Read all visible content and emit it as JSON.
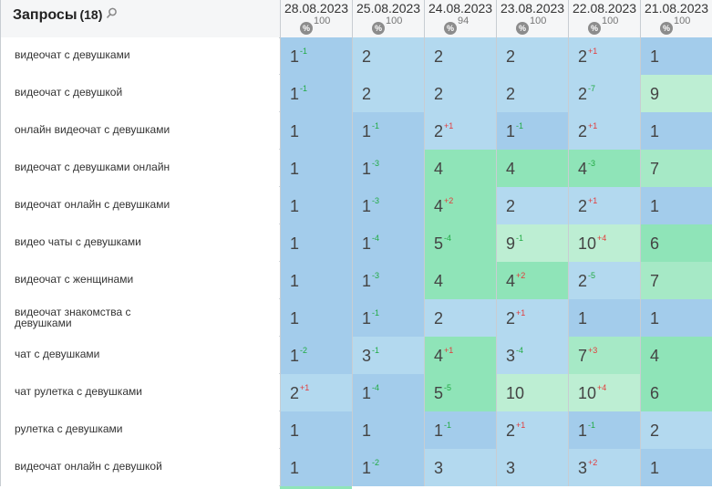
{
  "header": {
    "title": "Запросы",
    "count": "(18)",
    "dates": [
      {
        "date": "28.08.2023",
        "pct_icon": "%",
        "pct": "100"
      },
      {
        "date": "25.08.2023",
        "pct_icon": "%",
        "pct": "100"
      },
      {
        "date": "24.08.2023",
        "pct_icon": "%",
        "pct": "94"
      },
      {
        "date": "23.08.2023",
        "pct_icon": "%",
        "pct": "100"
      },
      {
        "date": "22.08.2023",
        "pct_icon": "%",
        "pct": "100"
      },
      {
        "date": "21.08.2023",
        "pct_icon": "%",
        "pct": "100"
      }
    ]
  },
  "rows": [
    {
      "query": "видеочат с девушками",
      "cells": [
        {
          "v": "1",
          "d": "-1",
          "dir": "up",
          "c": "blue1"
        },
        {
          "v": "2",
          "d": "",
          "dir": "",
          "c": "blue2"
        },
        {
          "v": "2",
          "d": "",
          "dir": "",
          "c": "blue2"
        },
        {
          "v": "2",
          "d": "",
          "dir": "",
          "c": "blue2"
        },
        {
          "v": "2",
          "d": "+1",
          "dir": "down",
          "c": "blue2"
        },
        {
          "v": "1",
          "d": "",
          "dir": "",
          "c": "blue1"
        }
      ]
    },
    {
      "query": "видеочат с девушкой",
      "cells": [
        {
          "v": "1",
          "d": "-1",
          "dir": "up",
          "c": "blue1"
        },
        {
          "v": "2",
          "d": "",
          "dir": "",
          "c": "blue2"
        },
        {
          "v": "2",
          "d": "",
          "dir": "",
          "c": "blue2"
        },
        {
          "v": "2",
          "d": "",
          "dir": "",
          "c": "blue2"
        },
        {
          "v": "2",
          "d": "-7",
          "dir": "up",
          "c": "blue2"
        },
        {
          "v": "9",
          "d": "",
          "dir": "",
          "c": "green2"
        }
      ]
    },
    {
      "query": "онлайн видеочат с девушками",
      "cells": [
        {
          "v": "1",
          "d": "",
          "dir": "",
          "c": "blue1"
        },
        {
          "v": "1",
          "d": "-1",
          "dir": "up",
          "c": "blue1"
        },
        {
          "v": "2",
          "d": "+1",
          "dir": "down",
          "c": "blue2"
        },
        {
          "v": "1",
          "d": "-1",
          "dir": "up",
          "c": "blue1"
        },
        {
          "v": "2",
          "d": "+1",
          "dir": "down",
          "c": "blue2"
        },
        {
          "v": "1",
          "d": "",
          "dir": "",
          "c": "blue1"
        }
      ]
    },
    {
      "query": "видеочат с девушками онлайн",
      "cells": [
        {
          "v": "1",
          "d": "",
          "dir": "",
          "c": "blue1"
        },
        {
          "v": "1",
          "d": "-3",
          "dir": "up",
          "c": "blue1"
        },
        {
          "v": "4",
          "d": "",
          "dir": "",
          "c": "green1"
        },
        {
          "v": "4",
          "d": "",
          "dir": "",
          "c": "green1"
        },
        {
          "v": "4",
          "d": "-3",
          "dir": "up",
          "c": "green1"
        },
        {
          "v": "7",
          "d": "",
          "dir": "",
          "c": "green3"
        }
      ]
    },
    {
      "query": "видеочат онлайн с девушками",
      "cells": [
        {
          "v": "1",
          "d": "",
          "dir": "",
          "c": "blue1"
        },
        {
          "v": "1",
          "d": "-3",
          "dir": "up",
          "c": "blue1"
        },
        {
          "v": "4",
          "d": "+2",
          "dir": "down",
          "c": "green1"
        },
        {
          "v": "2",
          "d": "",
          "dir": "",
          "c": "blue2"
        },
        {
          "v": "2",
          "d": "+1",
          "dir": "down",
          "c": "blue2"
        },
        {
          "v": "1",
          "d": "",
          "dir": "",
          "c": "blue1"
        }
      ]
    },
    {
      "query": "видео чаты с девушками",
      "cells": [
        {
          "v": "1",
          "d": "",
          "dir": "",
          "c": "blue1"
        },
        {
          "v": "1",
          "d": "-4",
          "dir": "up",
          "c": "blue1"
        },
        {
          "v": "5",
          "d": "-4",
          "dir": "up",
          "c": "green1"
        },
        {
          "v": "9",
          "d": "-1",
          "dir": "up",
          "c": "green2"
        },
        {
          "v": "10",
          "d": "+4",
          "dir": "down",
          "c": "green2"
        },
        {
          "v": "6",
          "d": "",
          "dir": "",
          "c": "green1"
        }
      ]
    },
    {
      "query": "видеочат с женщинами",
      "cells": [
        {
          "v": "1",
          "d": "",
          "dir": "",
          "c": "blue1"
        },
        {
          "v": "1",
          "d": "-3",
          "dir": "up",
          "c": "blue1"
        },
        {
          "v": "4",
          "d": "",
          "dir": "",
          "c": "green1"
        },
        {
          "v": "4",
          "d": "+2",
          "dir": "down",
          "c": "green1"
        },
        {
          "v": "2",
          "d": "-5",
          "dir": "up",
          "c": "blue2"
        },
        {
          "v": "7",
          "d": "",
          "dir": "",
          "c": "green3"
        }
      ]
    },
    {
      "query": "видеочат знакомства с девушками",
      "cells": [
        {
          "v": "1",
          "d": "",
          "dir": "",
          "c": "blue1"
        },
        {
          "v": "1",
          "d": "-1",
          "dir": "up",
          "c": "blue1"
        },
        {
          "v": "2",
          "d": "",
          "dir": "",
          "c": "blue2"
        },
        {
          "v": "2",
          "d": "+1",
          "dir": "down",
          "c": "blue2"
        },
        {
          "v": "1",
          "d": "",
          "dir": "",
          "c": "blue1"
        },
        {
          "v": "1",
          "d": "",
          "dir": "",
          "c": "blue1"
        }
      ]
    },
    {
      "query": "чат с девушками",
      "cells": [
        {
          "v": "1",
          "d": "-2",
          "dir": "up",
          "c": "blue1"
        },
        {
          "v": "3",
          "d": "-1",
          "dir": "up",
          "c": "blue2"
        },
        {
          "v": "4",
          "d": "+1",
          "dir": "down",
          "c": "green1"
        },
        {
          "v": "3",
          "d": "-4",
          "dir": "up",
          "c": "blue2"
        },
        {
          "v": "7",
          "d": "+3",
          "dir": "down",
          "c": "green3"
        },
        {
          "v": "4",
          "d": "",
          "dir": "",
          "c": "green1"
        }
      ]
    },
    {
      "query": "чат рулетка с девушками",
      "cells": [
        {
          "v": "2",
          "d": "+1",
          "dir": "down",
          "c": "blue2"
        },
        {
          "v": "1",
          "d": "-4",
          "dir": "up",
          "c": "blue1"
        },
        {
          "v": "5",
          "d": "-5",
          "dir": "up",
          "c": "green1"
        },
        {
          "v": "10",
          "d": "",
          "dir": "",
          "c": "green2"
        },
        {
          "v": "10",
          "d": "+4",
          "dir": "down",
          "c": "green2"
        },
        {
          "v": "6",
          "d": "",
          "dir": "",
          "c": "green1"
        }
      ]
    },
    {
      "query": "рулетка с девушками",
      "cells": [
        {
          "v": "1",
          "d": "",
          "dir": "",
          "c": "blue1"
        },
        {
          "v": "1",
          "d": "",
          "dir": "",
          "c": "blue1"
        },
        {
          "v": "1",
          "d": "-1",
          "dir": "up",
          "c": "blue1"
        },
        {
          "v": "2",
          "d": "+1",
          "dir": "down",
          "c": "blue2"
        },
        {
          "v": "1",
          "d": "-1",
          "dir": "up",
          "c": "blue1"
        },
        {
          "v": "2",
          "d": "",
          "dir": "",
          "c": "blue2"
        }
      ]
    },
    {
      "query": "видеочат онлайн с девушкой",
      "cells": [
        {
          "v": "1",
          "d": "",
          "dir": "",
          "c": "blue1"
        },
        {
          "v": "1",
          "d": "-2",
          "dir": "up",
          "c": "blue1"
        },
        {
          "v": "3",
          "d": "",
          "dir": "",
          "c": "blue2"
        },
        {
          "v": "3",
          "d": "",
          "dir": "",
          "c": "blue2"
        },
        {
          "v": "3",
          "d": "+2",
          "dir": "down",
          "c": "blue2"
        },
        {
          "v": "1",
          "d": "",
          "dir": "",
          "c": "blue1"
        }
      ]
    }
  ],
  "colors": {
    "blue1": "#a3cceb",
    "blue2": "#b3d9ef",
    "green1": "#8fe4b8",
    "green2": "#bdeed3",
    "green3": "#a6e9c6",
    "delta_up": "#22aa44",
    "delta_down": "#e23b3b"
  }
}
